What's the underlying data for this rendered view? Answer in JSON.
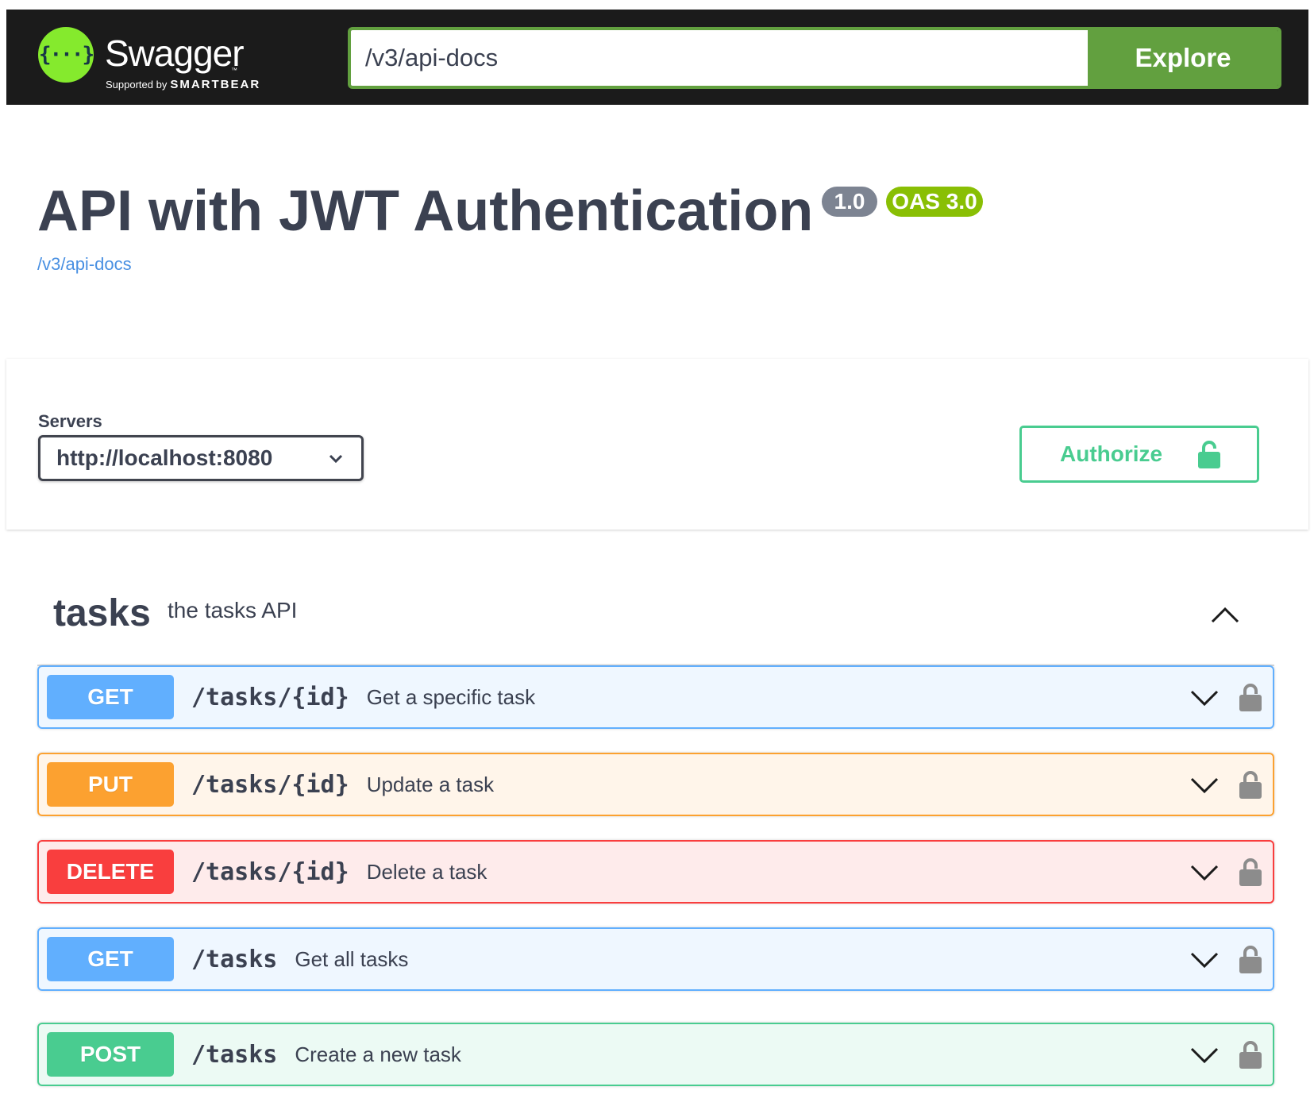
{
  "topbar": {
    "logo_name": "Swagger",
    "logo_tm": "™",
    "logo_supported_by": "Supported by",
    "logo_company": "SMARTBEAR",
    "logo_glyph": "{···}",
    "url_value": "/v3/api-docs",
    "explore_label": "Explore"
  },
  "info": {
    "title": "API with JWT Authentication",
    "version": "1.0",
    "oas_version": "OAS 3.0",
    "spec_link": "/v3/api-docs"
  },
  "servers": {
    "label": "Servers",
    "selected": "http://localhost:8080"
  },
  "authorize": {
    "label": "Authorize"
  },
  "tag": {
    "name": "tasks",
    "description": "the tasks API"
  },
  "operations": [
    {
      "method": "GET",
      "path": "/tasks/{id}",
      "summary": "Get a specific task"
    },
    {
      "method": "PUT",
      "path": "/tasks/{id}",
      "summary": "Update a task"
    },
    {
      "method": "DELETE",
      "path": "/tasks/{id}",
      "summary": "Delete a task"
    },
    {
      "method": "GET",
      "path": "/tasks",
      "summary": "Get all tasks"
    },
    {
      "method": "POST",
      "path": "/tasks",
      "summary": "Create a new task"
    }
  ],
  "colors": {
    "topbar_bg": "#1b1b1b",
    "explore_green": "#62a03f",
    "logo_green": "#85ea2d",
    "get": "#61affe",
    "put": "#fca130",
    "delete": "#f93e3e",
    "post": "#49cc90",
    "version_badge": "#7d8492",
    "oas_badge": "#89bf04",
    "link": "#4990e2"
  },
  "icons": {
    "logo": "swagger-logo-icon",
    "servers_dropdown": "chevron-down-icon",
    "authorize": "unlocked-padlock-icon",
    "tag_toggle": "chevron-up-icon",
    "operation_expand": "chevron-down-icon",
    "operation_lock": "unlocked-padlock-icon"
  }
}
